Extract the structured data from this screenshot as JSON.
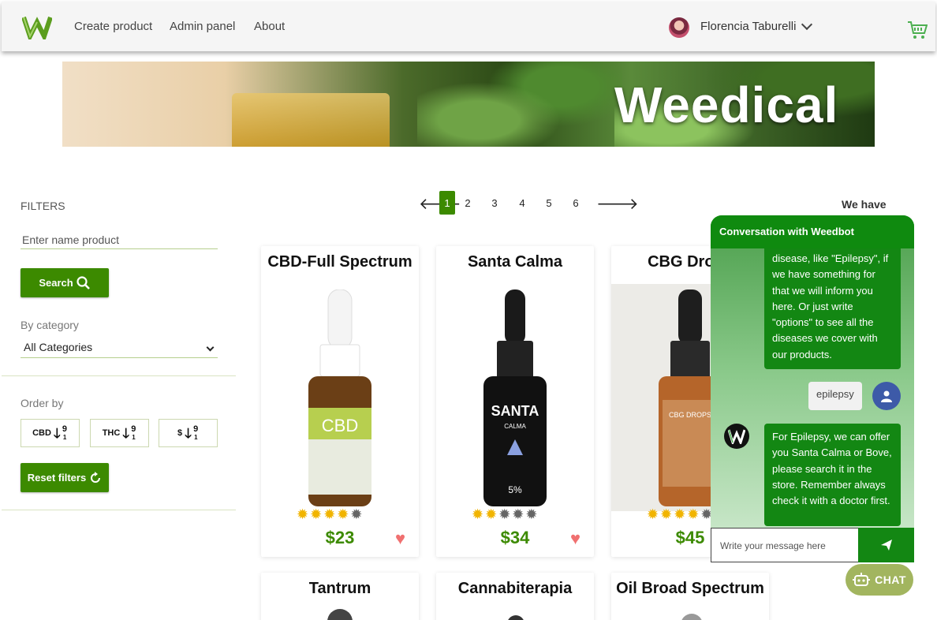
{
  "nav": {
    "links": [
      "Create product",
      "Admin panel",
      "About"
    ],
    "user_name": "Florencia Taburelli",
    "logo_icon": "weedical-logo",
    "cart_icon": "cart-icon"
  },
  "banner": {
    "brand": "Weedical"
  },
  "filters": {
    "title": "FILTERS",
    "name_placeholder": "Enter name product",
    "search_label": "Search",
    "category_label": "By category",
    "category_value": "All Categories",
    "order_label": "Order by",
    "order_buttons": [
      "CBD",
      "THC",
      "$"
    ],
    "reset_label": "Reset filters"
  },
  "pagination": {
    "pages": [
      "1",
      "2",
      "3",
      "4",
      "5",
      "6"
    ],
    "current": "1"
  },
  "we_have": "We have",
  "products": [
    {
      "name": "CBD-Full Spectrum",
      "price": "$23",
      "rating": 4
    },
    {
      "name": "Santa Calma",
      "price": "$34",
      "rating": 2
    },
    {
      "name": "CBG Drops",
      "price": "$45",
      "rating": 4
    },
    {
      "name": "Tantrum"
    },
    {
      "name": "Cannabiterapia"
    },
    {
      "name": "Oil Broad Spectrum"
    }
  ],
  "chat": {
    "title": "Conversation with Weedbot",
    "messages": [
      {
        "from": "bot",
        "text": "disease, like \"Epilepsy\", if we have something for that we will inform you here. Or just write \"options\" to see all the diseases we cover with our products."
      },
      {
        "from": "user",
        "text": "epilepsy"
      },
      {
        "from": "bot",
        "text": "For Epilepsy, we can offer you Santa Calma or Bove, please search it in the store. Remember always check it with a doctor first."
      }
    ],
    "input_placeholder": "Write your message here",
    "chat_button": "CHAT"
  },
  "colors": {
    "accent": "#3c8a00",
    "chat_green": "#138713",
    "star": "#f1b400",
    "heart": "#f07070"
  }
}
